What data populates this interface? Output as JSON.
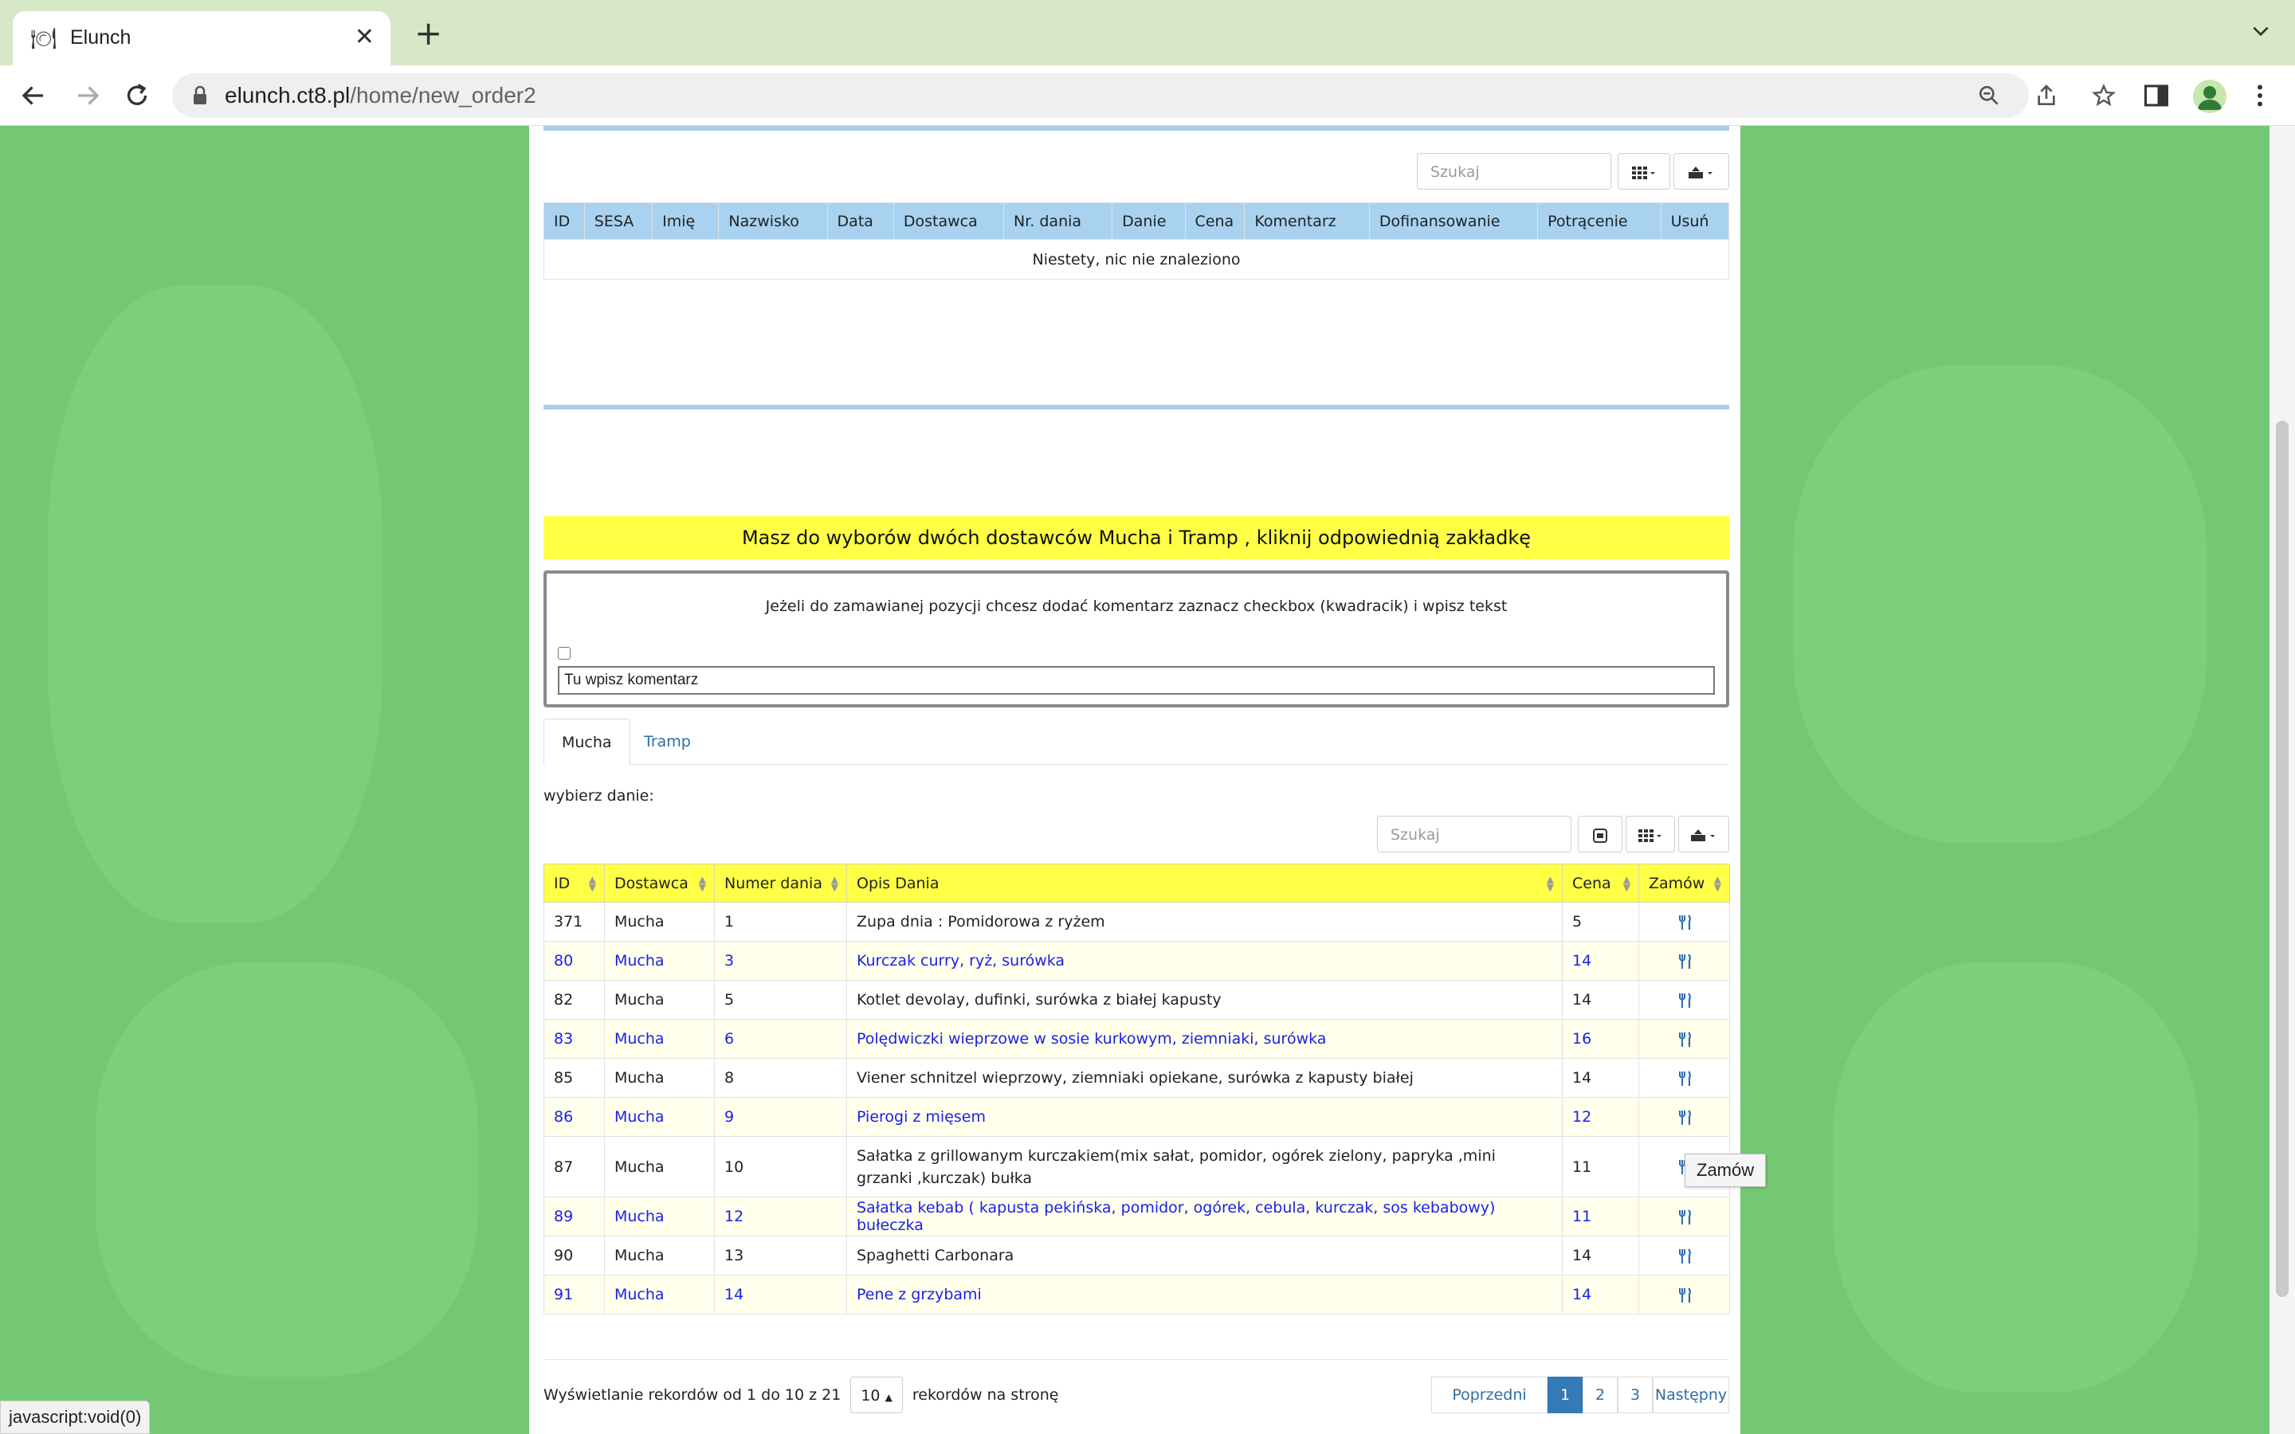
{
  "browser": {
    "tab_title": "Elunch",
    "url_host": "elunch.ct8.pl",
    "url_path": "/home/new_order2",
    "status_text": "javascript:void(0)"
  },
  "orders_table": {
    "search_placeholder": "Szukaj",
    "columns": [
      "ID",
      "SESA",
      "Imię",
      "Nazwisko",
      "Data",
      "Dostawca",
      "Nr. dania",
      "Danie",
      "Cena",
      "Komentarz",
      "Dofinansowanie",
      "Potrącenie",
      "Usuń"
    ],
    "empty_message": "Niestety, nic nie znaleziono"
  },
  "banner": "Masz do wyborów dwóch dostawców Mucha i Tramp , kliknij odpowiednią zakładkę",
  "comment": {
    "info": "Jeżeli do zamawianej pozycji chcesz dodać komentarz zaznacz checkbox (kwadracik) i wpisz tekst",
    "placeholder": "Tu wpisz komentarz"
  },
  "tabs": [
    "Mucha",
    "Tramp"
  ],
  "choose_label": "wybierz danie:",
  "menu_table": {
    "search_placeholder": "Szukaj",
    "columns": [
      "ID",
      "Dostawca",
      "Numer dania",
      "Opis Dania",
      "Cena",
      "Zamów"
    ],
    "rows": [
      {
        "id": "371",
        "supplier": "Mucha",
        "number": "1",
        "description": "Zupa dnia : Pomidorowa z ryżem",
        "price": "5"
      },
      {
        "id": "80",
        "supplier": "Mucha",
        "number": "3",
        "description": "Kurczak curry, ryż, surówka",
        "price": "14"
      },
      {
        "id": "82",
        "supplier": "Mucha",
        "number": "5",
        "description": "Kotlet devolay, dufinki, surówka z białej kapusty",
        "price": "14"
      },
      {
        "id": "83",
        "supplier": "Mucha",
        "number": "6",
        "description": "Polędwiczki wieprzowe w sosie kurkowym, ziemniaki, surówka",
        "price": "16"
      },
      {
        "id": "85",
        "supplier": "Mucha",
        "number": "8",
        "description": "Viener schnitzel wieprzowy, ziemniaki opiekane, surówka z kapusty białej",
        "price": "14"
      },
      {
        "id": "86",
        "supplier": "Mucha",
        "number": "9",
        "description": "Pierogi z mięsem",
        "price": "12"
      },
      {
        "id": "87",
        "supplier": "Mucha",
        "number": "10",
        "description": "Sałatka z grillowanym kurczakiem(mix sałat, pomidor, ogórek zielony, papryka ,mini grzanki ,kurczak) bułka",
        "price": "11"
      },
      {
        "id": "89",
        "supplier": "Mucha",
        "number": "12",
        "description": "Sałatka kebab ( kapusta pekińska, pomidor, ogórek, cebula, kurczak, sos kebabowy) bułeczka",
        "price": "11"
      },
      {
        "id": "90",
        "supplier": "Mucha",
        "number": "13",
        "description": "Spaghetti Carbonara",
        "price": "14"
      },
      {
        "id": "91",
        "supplier": "Mucha",
        "number": "14",
        "description": "Pene z grzybami",
        "price": "14"
      }
    ],
    "tooltip": "Zamów"
  },
  "pagination": {
    "records_prefix": "Wyświetlanie rekordów od 1 do 10 z 21",
    "page_size": "10",
    "records_suffix": "rekordów na stronę",
    "prev": "Poprzedni",
    "pages": [
      "1",
      "2",
      "3"
    ],
    "next": "Następny",
    "current_page": "1"
  },
  "colors": {
    "banner": "#ffff46",
    "header_blue": "#a8d2ef",
    "link_blue": "#1a22e8",
    "page_bg": "#74c874"
  }
}
